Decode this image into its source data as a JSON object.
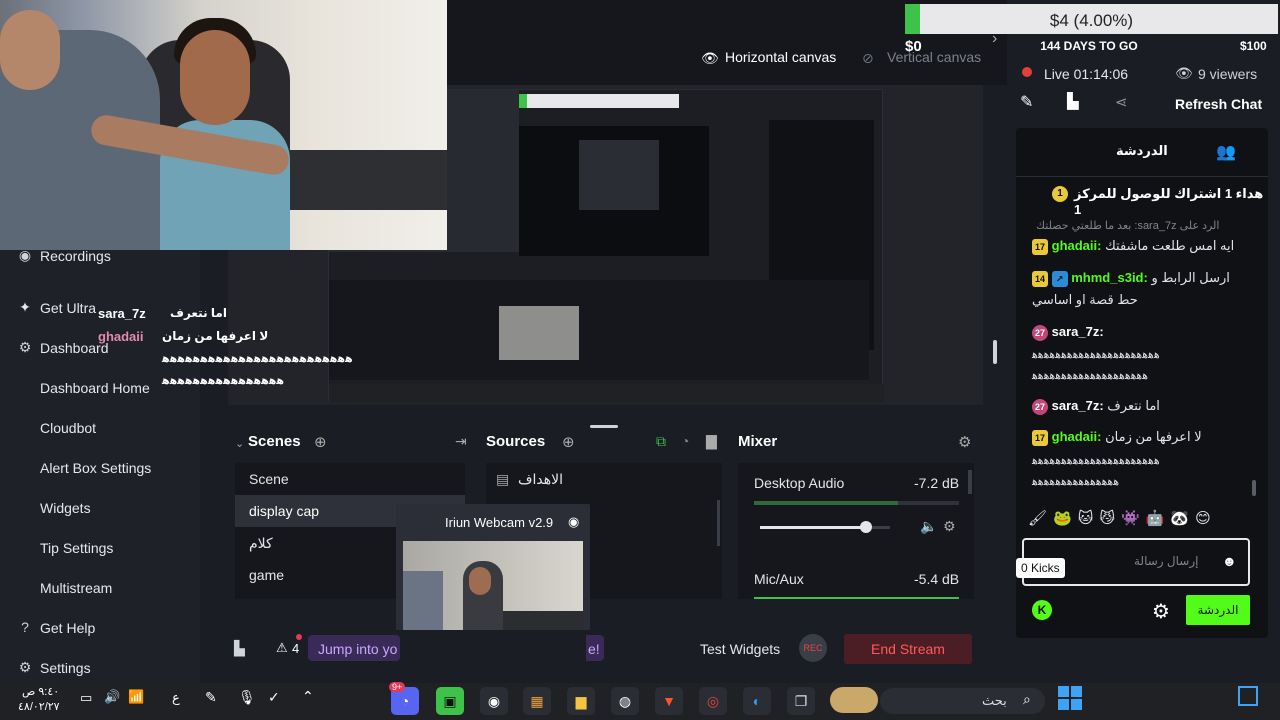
{
  "overlay": {
    "user1": "sara_7z",
    "msg1": "اما نتعرف",
    "user2": "ghadaii",
    "msg2": "لا اعرفها من زمان",
    "line3": "ﻫﻫﻫﻫﻫﻫﻫﻫﻫﻫﻫﻫﻫﻫﻫﻫﻫﻫﻫﻫﻫﻫﻫﻫﻫ",
    "line4": "ﻫﻫﻫﻫﻫﻫﻫﻫﻫﻫﻫﻫﻫﻫﻫﻫ"
  },
  "sidebar": {
    "items": [
      {
        "label": "Recordings",
        "icon": "record-icon"
      },
      {
        "label": "Get Ultra",
        "icon": "ultra-icon"
      },
      {
        "label": "Dashboard",
        "icon": "dashboard-icon"
      },
      {
        "label": "Dashboard Home"
      },
      {
        "label": "Cloudbot"
      },
      {
        "label": "Alert Box Settings"
      },
      {
        "label": "Widgets"
      },
      {
        "label": "Tip Settings"
      },
      {
        "label": "Multistream"
      },
      {
        "label": "Get Help",
        "icon": "help-icon"
      },
      {
        "label": "Settings",
        "icon": "gear-icon"
      }
    ]
  },
  "topbar": {
    "horizontal_canvas": "Horizontal canvas",
    "vertical_canvas": "Vertical canvas"
  },
  "goal": {
    "text": "$4 (4.00%)",
    "progress": 0.04,
    "min": "$0",
    "max": "$100",
    "days": "144 DAYS TO GO"
  },
  "stream": {
    "live_label": "Live 01:14:06",
    "viewers": "9 viewers",
    "refresh_chat": "Refresh Chat"
  },
  "chat": {
    "tab_title": "الدردشة",
    "pinned": "هداء 1 اشتراك للوصول للمركز 1",
    "reply_preview": "بعد ما طلعتي حصلتك :sara_7z الرد على",
    "messages": [
      {
        "badge": "17",
        "user": "ghadaii:",
        "text": "ايه امس طلعت ماشفتك"
      },
      {
        "badge": "14",
        "user": "mhmd_s3id:",
        "text": "ارسل الرابط و",
        "text2": "حط قصة او اساسي"
      },
      {
        "badge": "27",
        "user": "sara_7z:",
        "text": "ﻫﻫﻫﻫﻫﻫﻫﻫﻫﻫﻫﻫﻫﻫﻫﻫﻫﻫﻫﻫﻫﻫ",
        "text2": "ﻫﻫﻫﻫﻫﻫﻫﻫﻫﻫﻫﻫﻫﻫﻫﻫﻫﻫﻫﻫ"
      },
      {
        "badge": "27",
        "user": "sara_7z:",
        "text": "اما نتعرف"
      },
      {
        "badge": "17",
        "user": "ghadaii:",
        "text": "لا اعرفها من زمان",
        "text2": "ﻫﻫﻫﻫﻫﻫﻫﻫﻫﻫﻫﻫﻫﻫﻫﻫﻫﻫﻫﻫﻫﻫ",
        "text3": "ﻫﻫﻫﻫﻫﻫﻫﻫﻫﻫﻫﻫﻫﻫﻫ"
      }
    ],
    "input_placeholder": "إرسال رسالة",
    "kicks": "0 Kicks",
    "send_button": "الدردشة"
  },
  "scenes": {
    "title": "Scenes",
    "items": [
      "Scene",
      "display cap",
      "كلام",
      "game"
    ]
  },
  "sources": {
    "title": "Sources",
    "items": [
      "الاهداف"
    ],
    "webcam_title": "Iriun Webcam v2.9"
  },
  "mixer": {
    "title": "Mixer",
    "channels": [
      {
        "name": "Desktop Audio",
        "db": "-7.2 dB"
      },
      {
        "name": "Mic/Aux",
        "db": "-5.4 dB"
      }
    ]
  },
  "status": {
    "alerts": "4",
    "promo": "Jump into yo",
    "promo_end": "e!",
    "test_widgets": "Test Widgets",
    "rec": "REC",
    "end_stream": "End Stream"
  },
  "taskbar": {
    "time": "٩:٤٠ ص",
    "date": "٤٨/٠٢/٢٧",
    "lang": "ع",
    "search": "بحث",
    "discord_badge": "9+"
  }
}
